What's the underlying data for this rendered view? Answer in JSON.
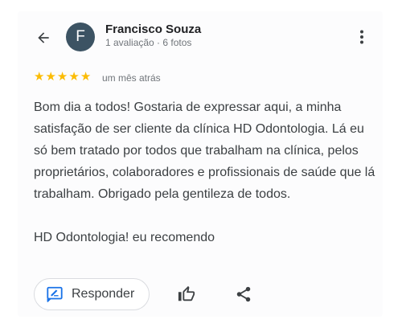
{
  "reviewer": {
    "initial": "F",
    "name": "Francisco Souza",
    "meta": "1 avaliação · 6 fotos"
  },
  "rating": {
    "stars": 5,
    "max": 5,
    "time": "um mês atrás"
  },
  "review": {
    "paragraph1": "Bom dia a todos! Gostaria de expressar aqui, a minha satisfação de ser cliente da clínica HD Odontologia. Lá eu só bem tratado por todos que trabalham na clínica, pelos proprietários, colaboradores e profissionais de saúde que lá trabalham. Obrigado pela gentileza de todos.",
    "paragraph2": "HD Odontologia! eu recomendo"
  },
  "actions": {
    "respond_label": "Responder"
  },
  "colors": {
    "star": "#fbbc04",
    "avatar_bg": "#3c5363",
    "respond_icon": "#1a73e8"
  },
  "icons": {
    "back": "arrow-back-icon",
    "more": "more-vert-icon",
    "respond": "rate-review-icon",
    "like": "thumb-up-icon",
    "share": "share-icon"
  }
}
